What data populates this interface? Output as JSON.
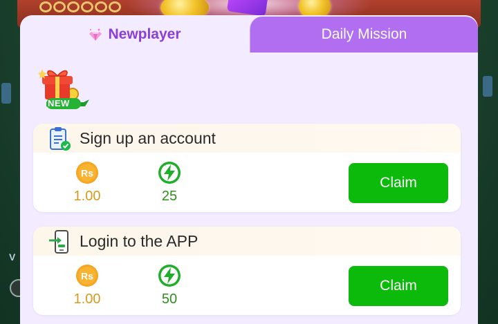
{
  "tabs": {
    "newplayer": "Newplayer",
    "daily_mission": "Daily Mission",
    "active": "Newplayer"
  },
  "badge": {
    "text": "NEW"
  },
  "tasks": [
    {
      "title": "Sign up an account",
      "icon": "clipboard-check-icon",
      "rs_symbol": "Rs",
      "rs_value": "1.00",
      "energy_value": "25",
      "claim_label": "Claim"
    },
    {
      "title": "Login to the APP",
      "icon": "phone-login-icon",
      "rs_symbol": "Rs",
      "rs_value": "1.00",
      "energy_value": "50",
      "claim_label": "Claim"
    }
  ],
  "colors": {
    "accent_purple": "#8a3fd8",
    "tab_inactive": "#b26ef0",
    "claim_green": "#0cba0c",
    "rs_gold": "#d89a1c",
    "energy_green": "#2f8f1c"
  }
}
